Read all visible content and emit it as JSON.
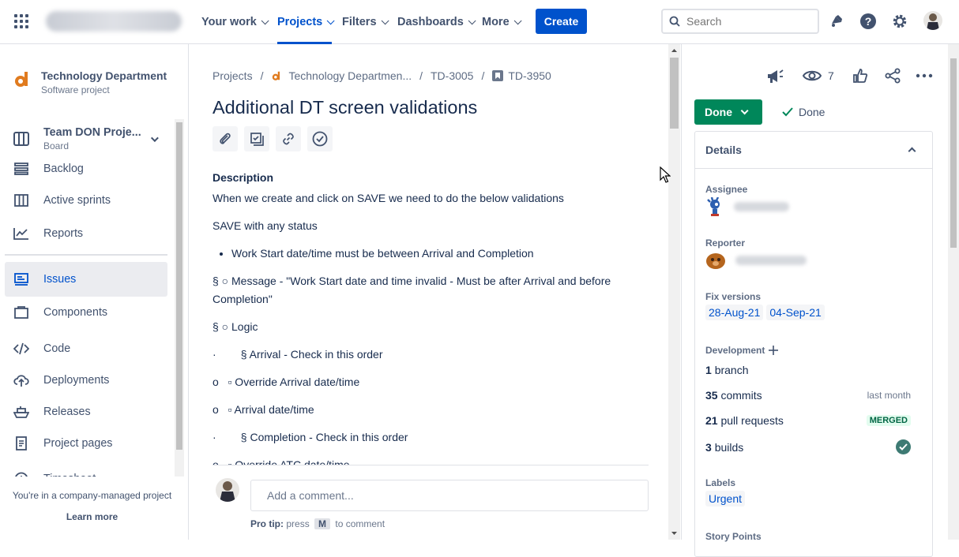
{
  "topbar": {
    "nav": [
      {
        "label": "Your work"
      },
      {
        "label": "Projects"
      },
      {
        "label": "Filters"
      },
      {
        "label": "Dashboards"
      },
      {
        "label": "More"
      }
    ],
    "create_label": "Create",
    "search_placeholder": "Search"
  },
  "sidebar": {
    "project_name": "Technology Department",
    "project_type": "Software project",
    "board_name": "Team DON Proje...",
    "board_sub": "Board",
    "items": [
      {
        "label": "Backlog"
      },
      {
        "label": "Active sprints"
      },
      {
        "label": "Reports"
      },
      {
        "label": "Issues"
      },
      {
        "label": "Components"
      },
      {
        "label": "Code"
      },
      {
        "label": "Deployments"
      },
      {
        "label": "Releases"
      },
      {
        "label": "Project pages"
      },
      {
        "label": "Timesheet"
      }
    ],
    "footer_text": "You're in a company-managed project",
    "learn_more": "Learn more"
  },
  "issue": {
    "breadcrumbs": [
      "Projects",
      "Technology Departmen...",
      "TD-3005",
      "TD-3950"
    ],
    "title": "Additional DT screen validations",
    "description_label": "Description",
    "lines": [
      "When we create and click on SAVE we need to do the below validations",
      "SAVE with any status",
      "Work Start date/time must be between Arrival and Completion",
      "§  ○ Message - \"Work Start date and time invalid - Must be after Arrival and before Completion\"",
      "§  ○ Logic",
      "·        § Arrival - Check in this order",
      "o   ▫ Override Arrival date/time",
      "o   ▫ Arrival date/time",
      "·        § Completion - Check in this order",
      "o   ▫ Override ATC date/time"
    ],
    "comment_placeholder": "Add a comment...",
    "protip_prefix": "Pro tip:",
    "protip_press": "press",
    "protip_key": "M",
    "protip_suffix": "to comment"
  },
  "right": {
    "watchers_count": "7",
    "status_label": "Done",
    "resolution_label": "Done",
    "details_label": "Details",
    "assignee_label": "Assignee",
    "reporter_label": "Reporter",
    "fix_versions_label": "Fix versions",
    "fix_versions": [
      "28-Aug-21",
      "04-Sep-21"
    ],
    "development_label": "Development",
    "branch_count": "1",
    "branch_label": "branch",
    "commits_count": "35",
    "commits_label": "commits",
    "commits_when": "last month",
    "pr_count": "21",
    "pr_label": "pull requests",
    "pr_status": "MERGED",
    "builds_count": "3",
    "builds_label": "builds",
    "labels_label": "Labels",
    "label_value": "Urgent",
    "story_points_label": "Story Points"
  },
  "colors": {
    "brand_blue": "#0052cc",
    "done_green": "#00875a",
    "merged_bg": "#e3fcef"
  }
}
